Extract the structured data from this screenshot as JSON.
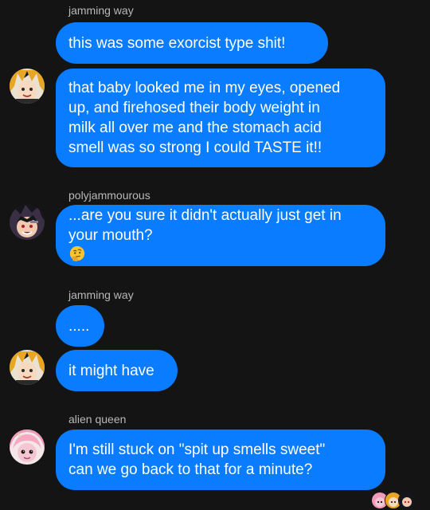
{
  "messages": [
    {
      "sender": "jamming way",
      "lines": [
        "this was some exorcist type shit!"
      ]
    },
    {
      "sender": "",
      "lines": [
        "that baby looked me in my eyes, opened",
        "up, and firehosed their body weight in",
        "milk all over me and the stomach acid",
        "smell was so strong I could TASTE it!!"
      ]
    },
    {
      "sender": "polyjammourous",
      "lines": [
        "...are you sure it didn't actually just get in",
        "your mouth?"
      ]
    },
    {
      "sender": "jamming way",
      "lines": [
        "....."
      ]
    },
    {
      "sender": "",
      "lines": [
        "it might have"
      ]
    },
    {
      "sender": "alien queen",
      "lines": [
        "I'm still stuck on \"spit up smells sweet\"",
        "can we go back to that for a minute?"
      ]
    }
  ],
  "icons": {
    "thinking_emoji": "thinking-face-emoji"
  },
  "colors": {
    "background": "#141414",
    "bubble": "#0a7cff",
    "bubble_text": "#ffffff",
    "sender_text": "#b9b9b9"
  }
}
